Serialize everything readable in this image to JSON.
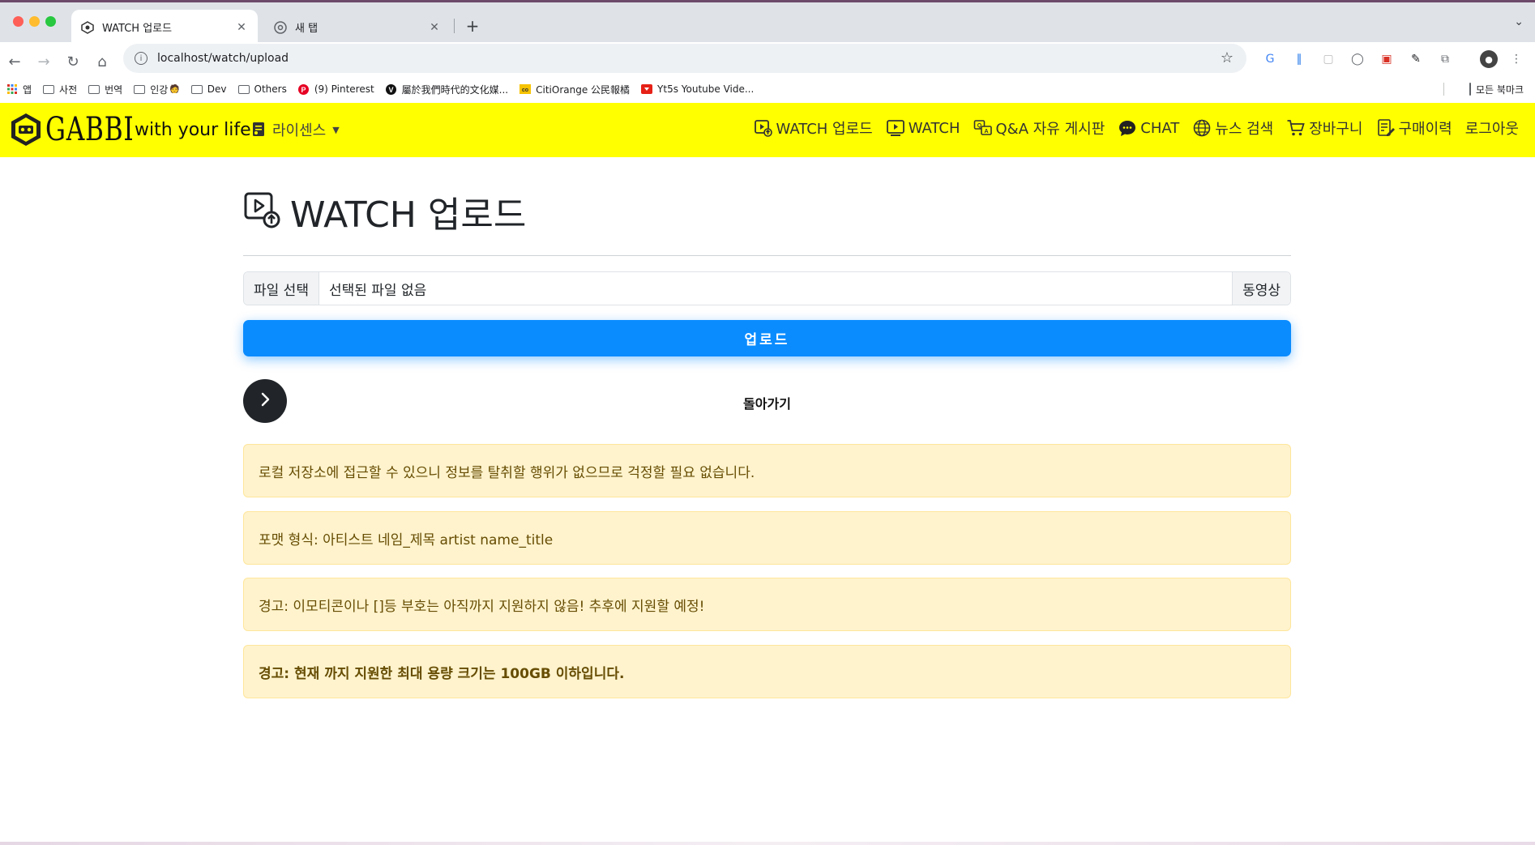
{
  "browser": {
    "tabs": [
      {
        "title": "WATCH 업로드",
        "active": true
      },
      {
        "title": "새 탭",
        "active": false
      }
    ],
    "new_tab": "+",
    "url": "localhost/watch/upload",
    "bookmarks": [
      {
        "label": "앱",
        "icon": "apps-grid-icon"
      },
      {
        "label": "사전",
        "icon": "folder-icon"
      },
      {
        "label": "번역",
        "icon": "folder-icon"
      },
      {
        "label": "인강",
        "icon": "folder-icon"
      },
      {
        "label": "Dev",
        "icon": "folder-icon"
      },
      {
        "label": "Others",
        "icon": "folder-icon"
      },
      {
        "label": "(9) Pinterest",
        "icon": "pinterest-icon"
      },
      {
        "label": "屬於我們時代的文化媒...",
        "icon": "v-logo-icon"
      },
      {
        "label": "CitiOrange 公民報橘",
        "icon": "citiorange-icon"
      },
      {
        "label": "Yt5s Youtube Vide...",
        "icon": "yt5s-icon"
      }
    ],
    "all_bookmarks": "모든 북마크"
  },
  "navbar": {
    "brand_word": "GABBI",
    "brand_tagline": "with your life",
    "license": "라이센스",
    "links": [
      {
        "label": "WATCH 업로드",
        "icon": "video-upload-icon"
      },
      {
        "label": "WATCH",
        "icon": "video-play-icon"
      },
      {
        "label": "Q&A 자유 게시판",
        "icon": "qa-board-icon"
      },
      {
        "label": "CHAT",
        "icon": "chat-bubble-icon"
      },
      {
        "label": "뉴스 검색",
        "icon": "globe-icon"
      },
      {
        "label": "장바구니",
        "icon": "cart-icon"
      },
      {
        "label": "구매이력",
        "icon": "receipt-icon"
      },
      {
        "label": "로그아웃",
        "icon": ""
      }
    ]
  },
  "main": {
    "title": "WATCH 업로드",
    "file": {
      "button": "파일 선택",
      "status": "선택된 파일 없음",
      "append": "동영상"
    },
    "upload_button": "업로드",
    "back_label": "돌아가기",
    "alerts": [
      {
        "text": "로컬 저장소에 접근할 수 있으니 정보를 탈취할 행위가 없으므로 걱정할 필요 없습니다.",
        "bold": false
      },
      {
        "text": "포맷 형식: 아티스트 네임_제목 artist name_title",
        "bold": false
      },
      {
        "text": "경고: 이모티콘이나 []등 부호는 아직까지 지원하지 않음! 추후에 지원할 예정!",
        "bold": false
      },
      {
        "text": "경고: 현재 까지 지원한 최대 용량 크기는 100GB 이하입니다.",
        "bold": true
      }
    ]
  },
  "colors": {
    "navbar_bg": "#ffff00",
    "upload_button": "#0a8cff",
    "alert_bg": "#fff3cd",
    "alert_text": "#664d03"
  }
}
